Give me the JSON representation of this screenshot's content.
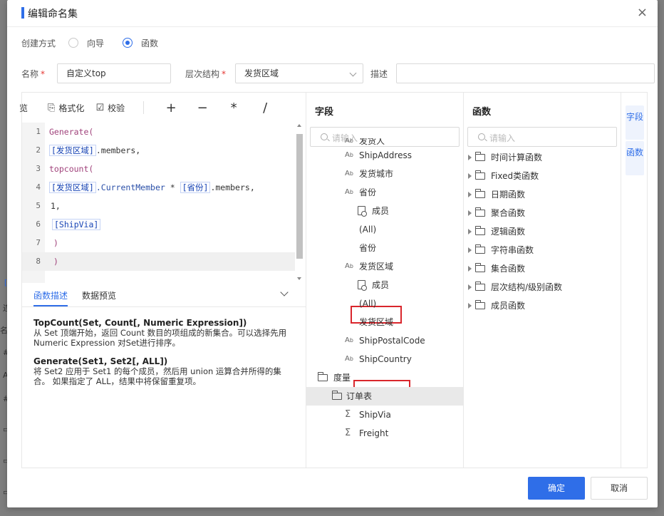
{
  "dialog": {
    "title": "编辑命名集"
  },
  "creation": {
    "label": "创建方式",
    "options": [
      "向导",
      "函数"
    ],
    "selected": "函数"
  },
  "form": {
    "name_label": "名称",
    "name_value": "自定义top",
    "hierarchy_label": "层次结构",
    "hierarchy_value": "发货区域",
    "desc_label": "描述",
    "desc_value": "",
    "required_mark": "*"
  },
  "toolbar": {
    "preview_label": "览",
    "format_label": "格式化",
    "validate_label": "校验",
    "ops": [
      "+",
      "−",
      "*",
      "/"
    ]
  },
  "code": {
    "line_numbers": [
      "1",
      "2",
      "3",
      "4",
      "5",
      "6",
      "7",
      "8"
    ],
    "l1": "Generate(",
    "l2_ref": "[发货区域]",
    "l2_rest": ".members,",
    "l3": "topcount(",
    "l4_ref1": "[发货区域]",
    "l4_prop": ".CurrentMember",
    "l4_op": " * ",
    "l4_ref2": "[省份]",
    "l4_rest": ".members,",
    "l5": "1,",
    "l6_ref": "[ShipVia]",
    "l7": ")",
    "l8": ")"
  },
  "desc_tabs": {
    "tab1": "函数描述",
    "tab2": "数据预览"
  },
  "description": {
    "topcount_sig": "TopCount(Set, Count[, Numeric Expression])",
    "topcount_text": "从 Set 顶端开始，返回 Count 数目的项组成的新集合。可以选择先用 Numeric Expression 对Set进行排序。",
    "generate_sig": "Generate(Set1, Set2[, ALL])",
    "generate_text": "将 Set2 应用于 Set1 的每个成员，然后用 union 运算合并所得的集合。 如果指定了 ALL，结果中将保留重复项。"
  },
  "fields": {
    "title": "字段",
    "search_placeholder": "请输入",
    "items": {
      "partial": "发货人",
      "ship_address": "ShipAddress",
      "ship_city": "发货城市",
      "province": "省份",
      "province_members": "成员",
      "province_all": "(All)",
      "province_level": "省份",
      "region": "发货区域",
      "region_members": "成员",
      "region_all": "(All)",
      "region_level": "发货区域",
      "postal": "ShipPostalCode",
      "country": "ShipCountry",
      "measures": "度量",
      "orders": "订单表",
      "shipvia": "ShipVia",
      "freight": "Freight"
    }
  },
  "functions": {
    "title": "函数",
    "search_placeholder": "请输入",
    "items": [
      "时间计算函数",
      "Fixed类函数",
      "日期函数",
      "聚合函数",
      "逻辑函数",
      "字符串函数",
      "集合函数",
      "层次结构/级别函数",
      "成员函数"
    ]
  },
  "side_tabs": {
    "fields": "字段",
    "functions": "函数"
  },
  "buttons": {
    "ok": "确定",
    "cancel": "取消"
  },
  "colors": {
    "accent": "#2f6ee8",
    "highlight": "#d9262c"
  }
}
